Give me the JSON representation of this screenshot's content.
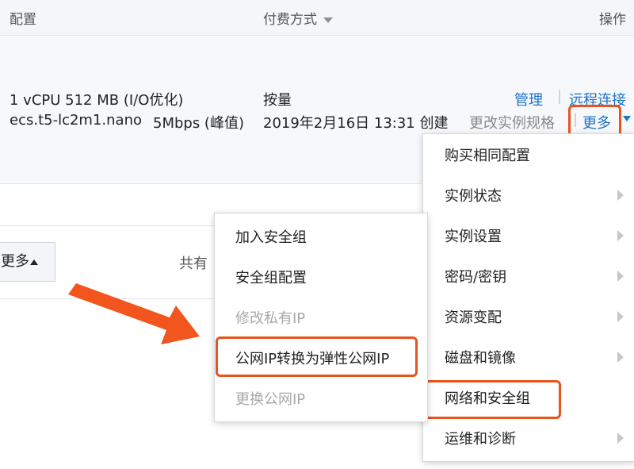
{
  "header": {
    "config": "配置",
    "payment": "付费方式",
    "actions": "操作"
  },
  "instance": {
    "spec": "1 vCPU 512 MB (I/O优化)",
    "type": "ecs.t5-lc2m1.nano",
    "bandwidth": "5Mbps (峰值)",
    "billing": "按量",
    "created": "2019年2月16日 13:31 创建",
    "manage": "管理",
    "remote": "远程连接",
    "change_spec": "更改实例规格",
    "more": "更多",
    "separator": "|"
  },
  "toolbar": {
    "more": "更多",
    "total_prefix": "共有"
  },
  "more_menu": [
    {
      "label": "购买相同配置",
      "submenu": false
    },
    {
      "label": "实例状态",
      "submenu": true
    },
    {
      "label": "实例设置",
      "submenu": true
    },
    {
      "label": "密码/密钥",
      "submenu": true
    },
    {
      "label": "资源变配",
      "submenu": true
    },
    {
      "label": "磁盘和镜像",
      "submenu": true
    },
    {
      "label": "网络和安全组",
      "submenu": false
    },
    {
      "label": "运维和诊断",
      "submenu": true
    }
  ],
  "network_submenu": [
    {
      "label": "加入安全组",
      "disabled": false
    },
    {
      "label": "安全组配置",
      "disabled": false
    },
    {
      "label": "修改私有IP",
      "disabled": true
    },
    {
      "label": "公网IP转换为弹性公网IP",
      "disabled": false
    },
    {
      "label": "更换公网IP",
      "disabled": true
    }
  ],
  "colors": {
    "link": "#1a73c7",
    "highlight": "#e9531e",
    "disabled": "#a8a8a8"
  }
}
